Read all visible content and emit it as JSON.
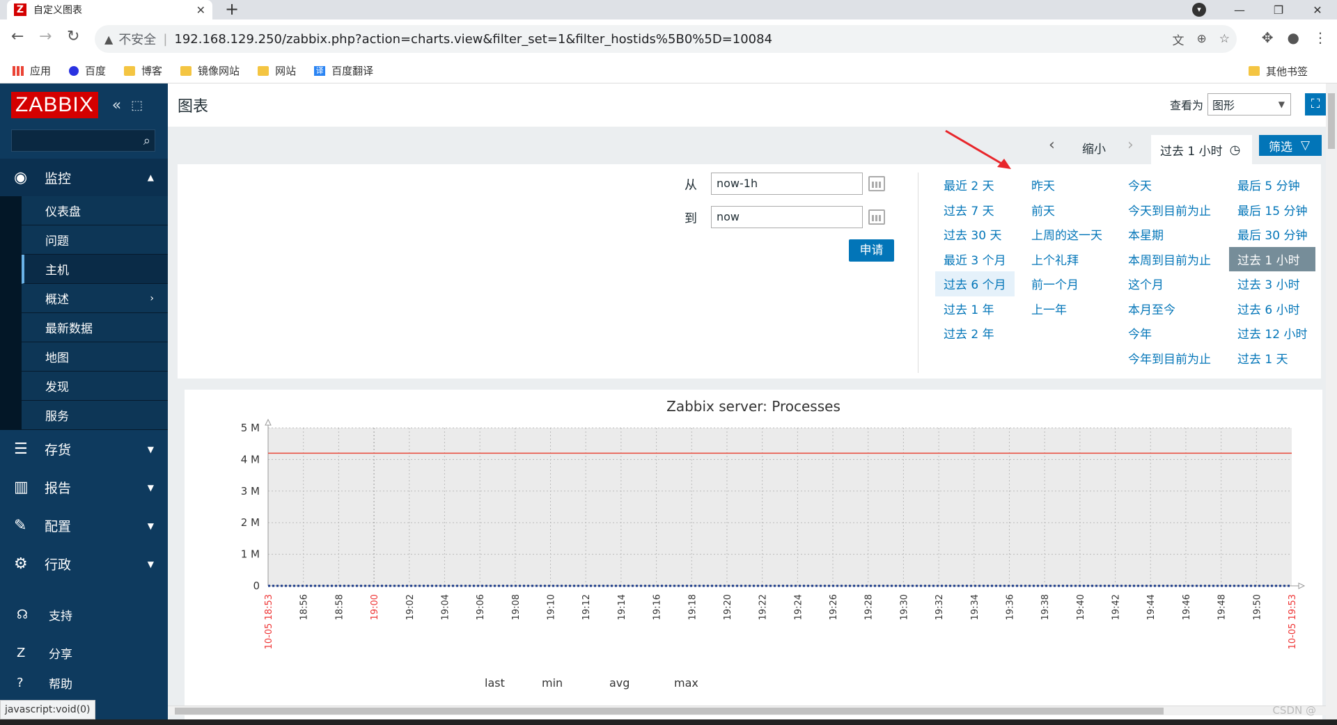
{
  "browser": {
    "tab_title": "自定义图表",
    "favicon_letter": "Z",
    "insecure_label": "不安全",
    "url": "192.168.129.250/zabbix.php?action=charts.view&filter_set=1&filter_hostids%5B0%5D=10084",
    "bookmarks": [
      "应用",
      "百度",
      "博客",
      "镜像网站",
      "网站",
      "百度翻译"
    ],
    "other_bookmarks": "其他书签",
    "status_text": "javascript:void(0)"
  },
  "sidebar": {
    "logo": "ZABBIX",
    "monitoring": {
      "label": "监控",
      "items": [
        "仪表盘",
        "问题",
        "主机",
        "概述",
        "最新数据",
        "地图",
        "发现",
        "服务"
      ]
    },
    "sections": [
      "存货",
      "报告",
      "配置",
      "行政"
    ],
    "bottom": [
      "支持",
      "分享",
      "帮助"
    ]
  },
  "header": {
    "title": "图表",
    "view_as_label": "查看为",
    "view_as_value": "图形"
  },
  "filter_tabs": {
    "zoom_out": "缩小",
    "current_range": "过去 1 小时",
    "filter_label": "筛选"
  },
  "time_filter": {
    "from_label": "从",
    "from_value": "now-1h",
    "to_label": "到",
    "to_value": "now",
    "apply_label": "申请",
    "quick_ranges": [
      [
        "最近 2 天",
        "过去 7 天",
        "过去 30 天",
        "最近 3 个月",
        "过去 6 个月",
        "过去 1 年",
        "过去 2 年"
      ],
      [
        "昨天",
        "前天",
        "上周的这一天",
        "上个礼拜",
        "前一个月",
        "上一年"
      ],
      [
        "今天",
        "今天到目前为止",
        "本星期",
        "本周到目前为止",
        "这个月",
        "本月至今",
        "今年",
        "今年到目前为止"
      ],
      [
        "最后 5 分钟",
        "最后 15 分钟",
        "最后 30 分钟",
        "过去 1 小时",
        "过去 3 小时",
        "过去 6 小时",
        "过去 12 小时",
        "过去 1 天"
      ]
    ],
    "highlighted": "过去 6 个月",
    "selected": "过去 1 小时"
  },
  "chart_data": {
    "type": "line",
    "title": "Zabbix server: Processes",
    "y_ticks": [
      "0",
      "1 M",
      "2 M",
      "3 M",
      "4 M",
      "5 M"
    ],
    "ylim": [
      0,
      5000000
    ],
    "x_ticks": [
      "10-05 18:53",
      "18:56",
      "18:58",
      "19:00",
      "19:02",
      "19:04",
      "19:06",
      "19:08",
      "19:10",
      "19:12",
      "19:14",
      "19:16",
      "19:18",
      "19:20",
      "19:22",
      "19:24",
      "19:26",
      "19:28",
      "19:30",
      "19:32",
      "19:34",
      "19:36",
      "19:38",
      "19:40",
      "19:42",
      "19:44",
      "19:46",
      "19:48",
      "19:50",
      "10-05 19:53"
    ],
    "red_ticks": [
      "10-05 18:53",
      "19:00",
      "10-05 19:53"
    ],
    "series": [
      {
        "values": [
          4200000,
          4200000
        ],
        "color": "#e8483a"
      },
      {
        "values": [
          0,
          0
        ],
        "color": "#1a3a8a",
        "style": "dotted"
      }
    ],
    "legend_headers": [
      "last",
      "min",
      "avg",
      "max"
    ],
    "grid": true
  },
  "watermark": "CSDN @"
}
